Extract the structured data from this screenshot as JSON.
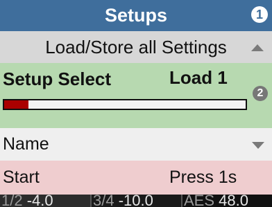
{
  "header": {
    "title": "Setups",
    "badge": "1"
  },
  "subheader": {
    "title": "Load/Store all Settings",
    "icon": "up-triangle-icon"
  },
  "setup_select": {
    "label": "Setup Select",
    "value": "Load 1",
    "badge": "2",
    "progress": 0.1
  },
  "name_field": {
    "label": "Name",
    "icon": "dropdown-triangle-icon"
  },
  "start": {
    "label": "Start",
    "value": "Press 1s"
  },
  "footer": {
    "segments": [
      {
        "channel": "1/2",
        "value": "-4.0"
      },
      {
        "channel": "3/4",
        "value": "-10.0"
      },
      {
        "channel": "AES",
        "value": "48.0"
      }
    ]
  },
  "colors": {
    "header_bg": "#3f6e9c",
    "subheader_bg": "#d7d7d7",
    "select_bg": "#b7d9b0",
    "progress_fill": "#aa0000",
    "name_bg": "#efefef",
    "start_bg": "#efcdcf",
    "footer_bg": "#111111"
  }
}
